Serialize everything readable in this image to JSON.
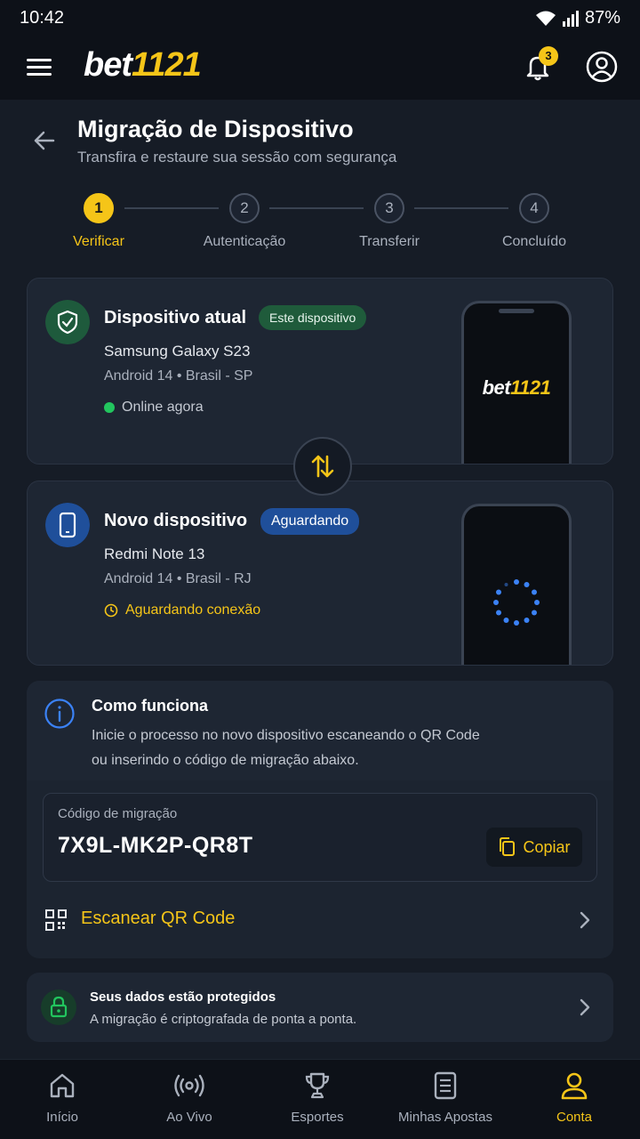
{
  "status_bar": {
    "time": "10:42",
    "battery": "87%"
  },
  "app_bar": {
    "logo_part1": "bet",
    "logo_part2": "1121",
    "notification_count": "3"
  },
  "header": {
    "title": "Migração de Dispositivo",
    "subtitle": "Transfira e restaure sua sessão com segurança"
  },
  "stepper": {
    "steps": [
      {
        "number": "1",
        "label": "Verificar"
      },
      {
        "number": "2",
        "label": "Autenticação"
      },
      {
        "number": "3",
        "label": "Transferir"
      },
      {
        "number": "4",
        "label": "Concluído"
      }
    ]
  },
  "current_device": {
    "title": "Dispositivo atual",
    "badge": "Este dispositivo",
    "model": "Samsung Galaxy S23",
    "meta": "Android 14 • Brasil - SP",
    "status": "Online agora",
    "phone_logo_part1": "bet",
    "phone_logo_part2": "1121"
  },
  "new_device": {
    "title": "Novo dispositivo",
    "badge": "Aguardando",
    "model": "Redmi Note 13",
    "meta": "Android 14 • Brasil - RJ",
    "status": "Aguardando conexão"
  },
  "how_it_works": {
    "title": "Como funciona",
    "line1": "Inicie o processo no novo dispositivo escaneando o QR Code",
    "line2": "ou inserindo o código de migração abaixo."
  },
  "migration_code": {
    "label": "Código de migração",
    "value": "7X9L-MK2P-QR8T",
    "copy_label": "Copiar"
  },
  "scan": {
    "label": "Escanear QR Code"
  },
  "security": {
    "title": "Seus dados estão protegidos",
    "text": "A migração é criptografada de ponta a ponta."
  },
  "bottom_nav": {
    "items": [
      {
        "label": "Início"
      },
      {
        "label": "Ao Vivo"
      },
      {
        "label": "Esportes"
      },
      {
        "label": "Minhas Apostas"
      },
      {
        "label": "Conta"
      }
    ]
  },
  "colors": {
    "accent": "#f5c518",
    "background": "#161c26",
    "card": "#1e2633",
    "success": "#22c55e",
    "info": "#3b82f6"
  }
}
